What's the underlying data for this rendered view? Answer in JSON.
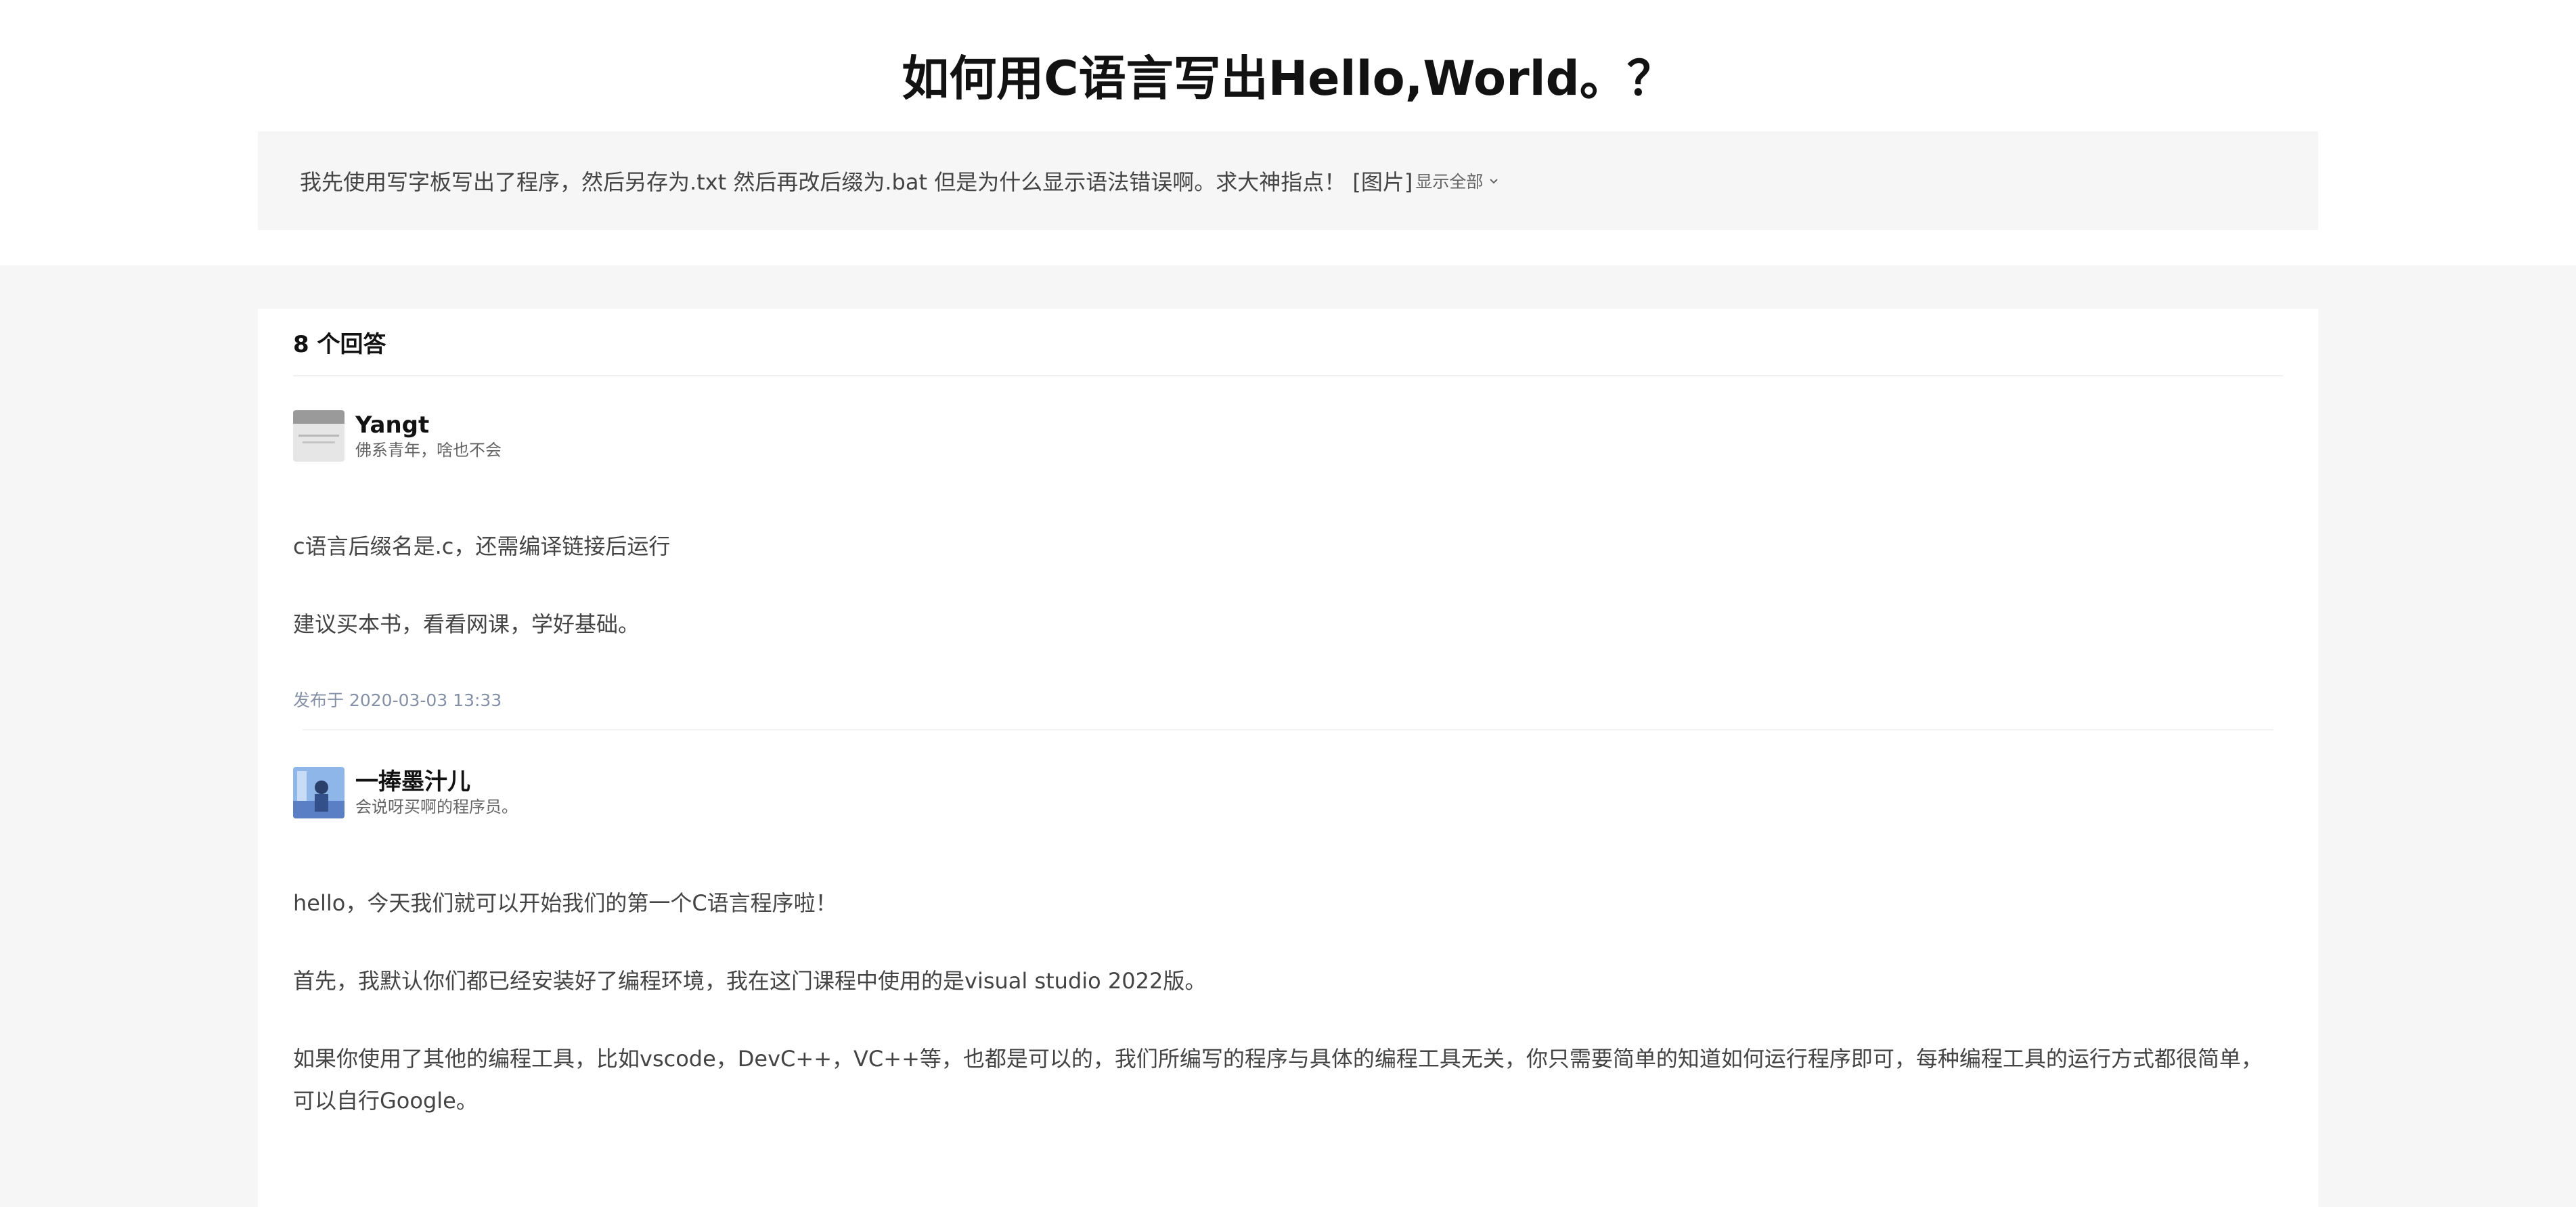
{
  "question": {
    "title": "如何用C语言写出Hello,World。？",
    "detail": "我先使用写字板写出了程序，然后另存为.txt 然后再改后缀为.bat 但是为什么显示语法错误啊。求大神指点！ [图片]",
    "show_all_label": "显示全部"
  },
  "answers_header": {
    "count_label": "8 个回答"
  },
  "answers": [
    {
      "author_name": "Yangt",
      "author_bio": "佛系青年，啥也不会",
      "paragraphs": [
        "c语言后缀名是.c，还需编译链接后运行",
        "建议买本书，看看网课，学好基础。"
      ],
      "time": "发布于 2020-03-03 13:33"
    },
    {
      "author_name": "一捧墨汁儿",
      "author_bio": "会说呀买啊的程序员。",
      "paragraphs": [
        "hello，今天我们就可以开始我们的第一个C语言程序啦！",
        "首先，我默认你们都已经安装好了编程环境，我在这门课程中使用的是visual studio 2022版。",
        "如果你使用了其他的编程工具，比如vscode，DevC++，VC++等，也都是可以的，我们所编写的程序与具体的编程工具无关，你只需要简单的知道如何运行程序即可，每种编程工具的运行方式都很简单，可以自行Google。"
      ]
    }
  ],
  "colors": {
    "page_bg": "#f6f6f6",
    "card_bg": "#ffffff",
    "title": "#121212",
    "body_text": "#444444",
    "meta_text": "#8590a6"
  }
}
